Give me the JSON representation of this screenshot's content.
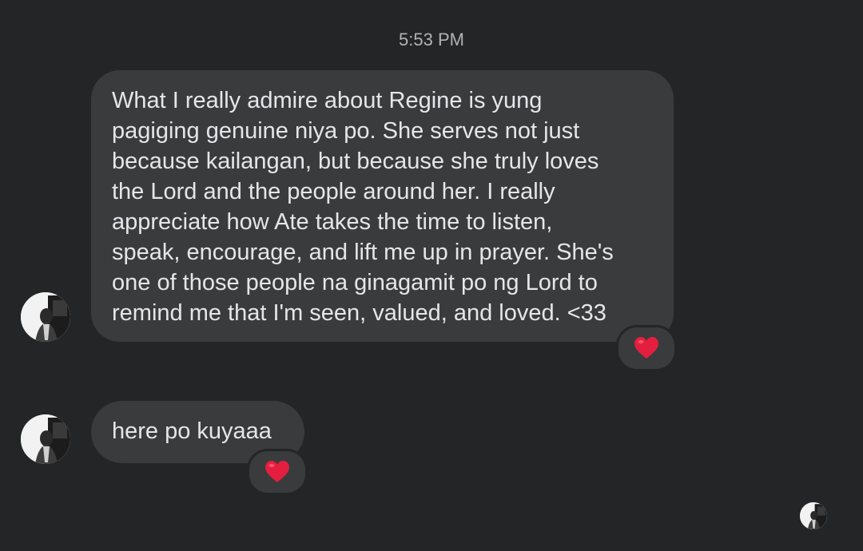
{
  "timestamp": "5:53 PM",
  "messages": [
    {
      "text": "What I really admire about Regine is yung\npagiging genuine niya po. She serves not just\nbecause kailangan, but because she truly loves\nthe Lord and the people around her. I really\nappreciate how Ate takes the time to listen,\nspeak, encourage, and lift me up in prayer. She's\none of those people na ginagamit po ng Lord to\nremind me that I'm seen, valued, and loved. <33",
      "reaction": "heart-icon"
    },
    {
      "text": "here po kuyaaa",
      "reaction": "heart-icon"
    }
  ],
  "colors": {
    "background": "#242526",
    "bubble": "#3a3b3c",
    "text": "#e4e6eb",
    "timestamp": "#b0b3b8",
    "heart": "#e41e3f"
  }
}
